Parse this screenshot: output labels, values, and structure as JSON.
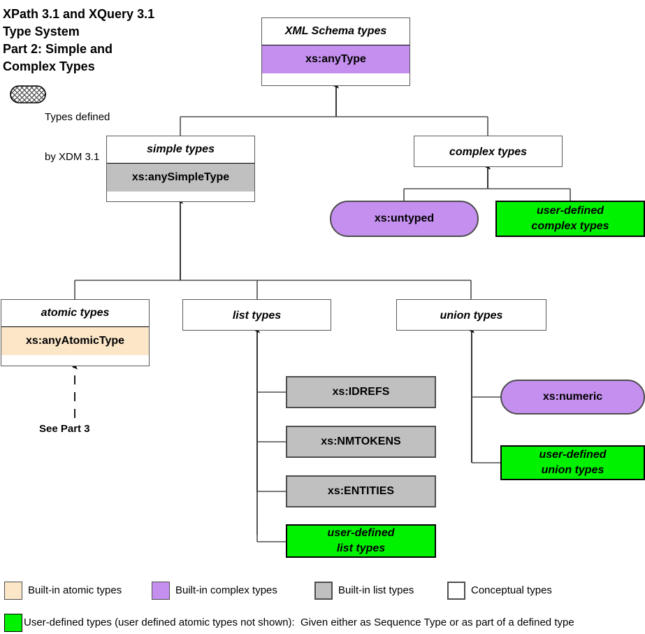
{
  "title": {
    "line1": "XPath 3.1 and XQuery 3.1",
    "line2": "Type System",
    "line3": "Part 2: Simple and",
    "line4": "Complex Types"
  },
  "xdm_legend": {
    "line1": "Types defined",
    "line2": "by XDM 3.1"
  },
  "colors": {
    "purple": "#c48fee",
    "grey": "#c0c0c0",
    "cream": "#fce6c8",
    "green": "#00f200",
    "white": "#ffffff",
    "border": "#595959",
    "line": "#4d4d4d"
  },
  "nodes": {
    "xml_schema_types": {
      "header": "XML Schema types",
      "value": "xs:anyType",
      "fill": "#c48fee"
    },
    "simple_types": {
      "header": "simple types",
      "value": "xs:anySimpleType",
      "fill": "#c0c0c0"
    },
    "complex_types": {
      "header": "complex types"
    },
    "atomic_types": {
      "header": "atomic types",
      "value": "xs:anyAtomicType",
      "fill": "#fce6c8"
    },
    "list_types": {
      "header": "list types"
    },
    "union_types": {
      "header": "union types"
    },
    "xs_untyped": {
      "label": "xs:untyped",
      "fill": "#c48fee"
    },
    "user_defined_complex": {
      "line1": "user-defined",
      "line2": "complex types",
      "fill": "#00f200"
    },
    "xs_idrefs": {
      "label": "xs:IDREFS",
      "fill": "#c0c0c0"
    },
    "xs_nmtokens": {
      "label": "xs:NMTOKENS",
      "fill": "#c0c0c0"
    },
    "xs_entities": {
      "label": "xs:ENTITIES",
      "fill": "#c0c0c0"
    },
    "user_defined_list": {
      "line1": "user-defined",
      "line2": "list types",
      "fill": "#00f200"
    },
    "xs_numeric": {
      "label": "xs:numeric",
      "fill": "#c48fee"
    },
    "user_defined_union": {
      "line1": "user-defined",
      "line2": "union types",
      "fill": "#00f200"
    }
  },
  "see_part_3": "See Part 3",
  "legend": {
    "items": [
      {
        "label": "Built-in atomic types",
        "fill": "#fce6c8"
      },
      {
        "label": "Built-in complex types",
        "fill": "#c48fee"
      },
      {
        "label": "Built-in list types",
        "fill": "#c0c0c0"
      },
      {
        "label": "Conceptual types",
        "fill": "#ffffff"
      }
    ],
    "user_defined": {
      "label": "User-defined types (user defined atomic types not shown):  Given either as Sequence Type or as part of a defined type",
      "fill": "#00f200"
    }
  }
}
